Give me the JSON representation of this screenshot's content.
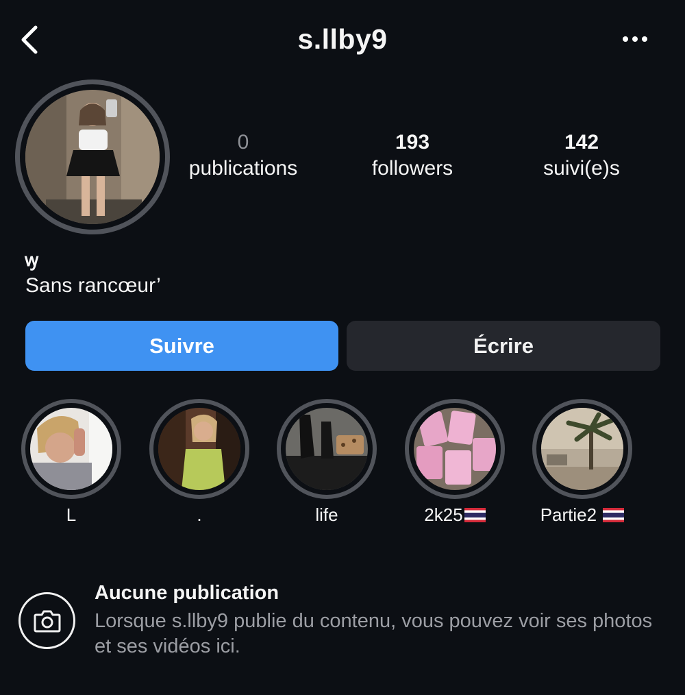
{
  "header": {
    "username": "s.llby9",
    "back_icon": "chevron-left-icon",
    "more_icon": "more-horizontal-icon"
  },
  "profile": {
    "stats": [
      {
        "value": "0",
        "label": "publications"
      },
      {
        "value": "193",
        "label": "followers"
      },
      {
        "value": "142",
        "label": "suivi(e)s"
      }
    ],
    "name_glyph": "ꝡ",
    "bio": "Sans rancœur’"
  },
  "actions": {
    "follow_label": "Suivre",
    "message_label": "Écrire"
  },
  "highlights": [
    {
      "label": "L"
    },
    {
      "label": "."
    },
    {
      "label": "life"
    },
    {
      "label": "2k25"
    },
    {
      "label": "Partie2 "
    }
  ],
  "empty_state": {
    "icon": "camera-icon",
    "title": "Aucune publication",
    "text": "Lorsque s.llby9 publie du contenu, vous pouvez voir ses photos et ses vidéos ici."
  },
  "colors": {
    "background": "#0c0f14",
    "follow_button": "#3f92f2",
    "message_button": "#25272d",
    "ring": "#51545b",
    "secondary_text": "#9c9ea4"
  }
}
